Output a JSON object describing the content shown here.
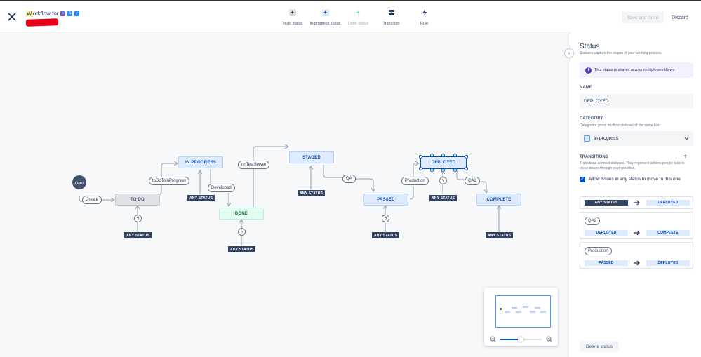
{
  "header": {
    "title_highlight": "W",
    "title_rest": "orkflow for",
    "badges": [
      {
        "icon": "v-badge-icon",
        "color": "#6554c0",
        "glyph": "V"
      },
      {
        "icon": "s-badge-icon",
        "color": "#2684ff",
        "glyph": "S"
      },
      {
        "icon": "check-badge-icon",
        "color": "#2684ff",
        "glyph": "✓"
      }
    ],
    "save_label": "Save and close",
    "discard_label": "Discard"
  },
  "toolbar": {
    "todo_status": "To-do status",
    "in_progress_status": "In-progress status",
    "done_status": "Done status",
    "transition": "Transition",
    "rule": "Rule"
  },
  "canvas": {
    "start": "START",
    "nodes": {
      "todo": "TO DO",
      "in_progress": "IN PROGRESS",
      "done": "DONE",
      "staged": "STAGED",
      "passed": "PASSED",
      "deployed": "DEPLOYED",
      "complete": "COMPLETE"
    },
    "transitions": {
      "create": "Create",
      "todo_to_in_progress": "toDoToInProgress",
      "developed": "Developed",
      "on_test_server": "onTestServer",
      "qa": "QA",
      "production": "Production",
      "qa2": "QA2"
    },
    "any_status": "ANY STATUS"
  },
  "panel": {
    "title": "Status",
    "subtitle": "Statuses capture the stages of your working process.",
    "info": "This status is shared across multiple workflows.",
    "name_label": "NAME",
    "name_value": "DEPLOYED",
    "category_label": "CATEGORY",
    "category_help": "Categories group multiple statuses of the same kind.",
    "category_value": "In progress",
    "transitions_label": "TRANSITIONS",
    "transitions_help": "Transitions connect statuses. They represent actions people take to move issues through your workflow.",
    "allow_any": "Allow issues in any status to move to this one",
    "cards": [
      {
        "name": "",
        "from": "ANY STATUS",
        "to": "DEPLOYED"
      },
      {
        "name": "QA2",
        "from": "DEPLOYED",
        "to": "COMPLETE"
      },
      {
        "name": "Production",
        "from": "PASSED",
        "to": "DEPLOYED"
      }
    ],
    "delete_label": "Delete status"
  },
  "colors": {
    "primary": "#0052cc",
    "todo_bg": "#dfe1e6",
    "progress_bg": "#deebff",
    "done_bg": "#e3fcef",
    "dark": "#344563"
  }
}
